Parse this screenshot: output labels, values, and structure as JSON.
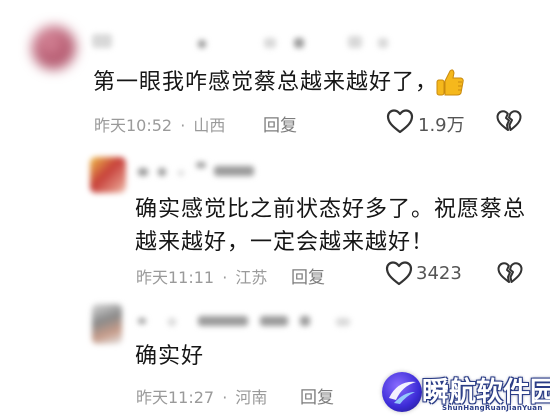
{
  "comments": [
    {
      "text": "第一眼我咋感觉蔡总越来越好了，",
      "emoji_icon": "thumbs-up-icon",
      "time": "昨天10:52",
      "dot": "·",
      "location": "山西",
      "reply_label": "回复",
      "like_count": "1.9万"
    },
    {
      "text_line1": "确实感觉比之前状态好多了。祝愿蔡总",
      "text_line2": "越来越好，一定会越来越好！",
      "time": "昨天11:11",
      "dot": "·",
      "location": "江苏",
      "reply_label": "回复",
      "like_count": "3423"
    },
    {
      "text": "确实好",
      "time": "昨天11:27",
      "dot": "·",
      "location": "河南",
      "reply_label": "回复"
    }
  ],
  "watermark": {
    "title": "瞬航软件园",
    "subtitle": "ShunHangRuanJianYuan",
    "logo_icon": "swoosh-logo-icon"
  },
  "colors": {
    "text": "#161616",
    "meta": "#9a9a9a",
    "icon": "#333333",
    "emoji": "#f5b81c",
    "watermark_blue": "#2a3c86"
  }
}
